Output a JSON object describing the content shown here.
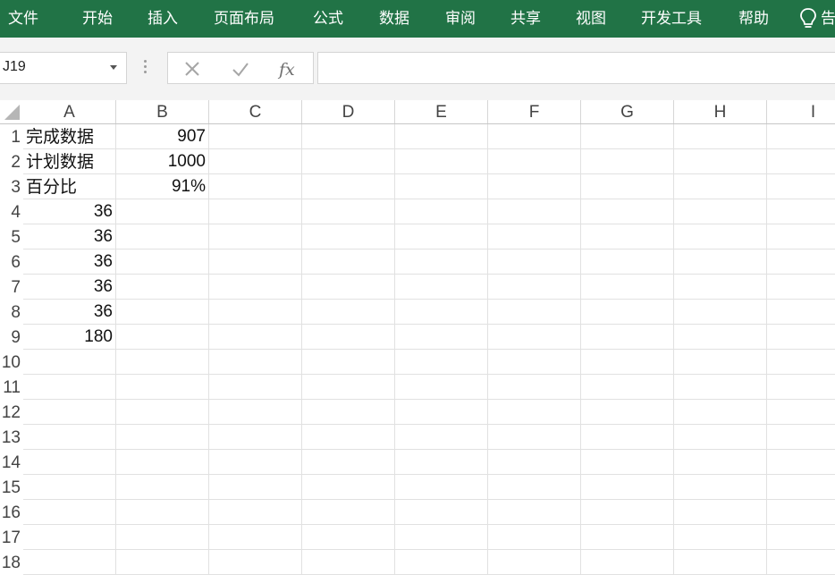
{
  "menu": {
    "items": [
      "文件",
      "开始",
      "插入",
      "页面布局",
      "公式",
      "数据",
      "审阅",
      "共享",
      "视图",
      "开发工具",
      "帮助"
    ],
    "tell_me_label": "告"
  },
  "colors": {
    "ribbon": "#217346",
    "grid_line": "#e1e1e1"
  },
  "formula_bar": {
    "name_box": "J19",
    "formula": "",
    "icons": [
      "cancel-icon",
      "enter-icon",
      "insert-function-icon"
    ]
  },
  "sheet": {
    "columns": [
      "A",
      "B",
      "C",
      "D",
      "E",
      "F",
      "G",
      "H",
      "I"
    ],
    "rows": [
      {
        "num": "1",
        "A": "完成数据",
        "B": "907"
      },
      {
        "num": "2",
        "A": "计划数据",
        "B": "1000"
      },
      {
        "num": "3",
        "A": "百分比",
        "B": "91%"
      },
      {
        "num": "4",
        "A": "36",
        "B": ""
      },
      {
        "num": "5",
        "A": "36",
        "B": ""
      },
      {
        "num": "6",
        "A": "36",
        "B": ""
      },
      {
        "num": "7",
        "A": "36",
        "B": ""
      },
      {
        "num": "8",
        "A": "36",
        "B": ""
      },
      {
        "num": "9",
        "A": "180",
        "B": ""
      },
      {
        "num": "10",
        "A": "",
        "B": ""
      },
      {
        "num": "11",
        "A": "",
        "B": ""
      },
      {
        "num": "12",
        "A": "",
        "B": ""
      },
      {
        "num": "13",
        "A": "",
        "B": ""
      },
      {
        "num": "14",
        "A": "",
        "B": ""
      },
      {
        "num": "15",
        "A": "",
        "B": ""
      },
      {
        "num": "16",
        "A": "",
        "B": ""
      },
      {
        "num": "17",
        "A": "",
        "B": ""
      },
      {
        "num": "18",
        "A": "",
        "B": ""
      }
    ]
  }
}
